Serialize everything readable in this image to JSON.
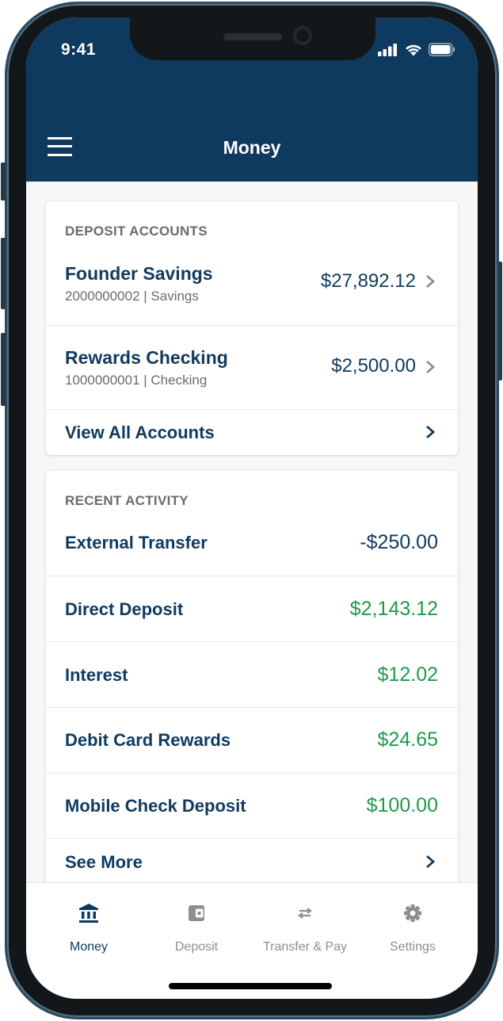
{
  "status_bar": {
    "time": "9:41"
  },
  "header": {
    "title": "Money",
    "menu_icon": "hamburger-menu-icon"
  },
  "deposit_accounts": {
    "label": "DEPOSIT ACCOUNTS",
    "accounts": [
      {
        "name": "Founder Savings",
        "number": "2000000002",
        "type": "Savings",
        "sub": "2000000002 | Savings",
        "balance": "$27,892.12"
      },
      {
        "name": "Rewards Checking",
        "number": "1000000001",
        "type": "Checking",
        "sub": "1000000001 | Checking",
        "balance": "$2,500.00"
      }
    ],
    "view_all_label": "View All Accounts"
  },
  "recent_activity": {
    "label": "RECENT ACTIVITY",
    "items": [
      {
        "name": "External Transfer",
        "amount": "-$250.00",
        "kind": "debit"
      },
      {
        "name": "Direct Deposit",
        "amount": "$2,143.12",
        "kind": "credit"
      },
      {
        "name": "Interest",
        "amount": "$12.02",
        "kind": "credit"
      },
      {
        "name": "Debit Card Rewards",
        "amount": "$24.65",
        "kind": "credit"
      },
      {
        "name": "Mobile Check Deposit",
        "amount": "$100.00",
        "kind": "credit"
      }
    ],
    "see_more_label": "See More"
  },
  "tab_bar": {
    "tabs": [
      {
        "label": "Money",
        "icon": "bank-icon",
        "active": true
      },
      {
        "label": "Deposit",
        "icon": "wallet-icon",
        "active": false
      },
      {
        "label": "Transfer & Pay",
        "icon": "transfer-arrows-icon",
        "active": false
      },
      {
        "label": "Settings",
        "icon": "gear-icon",
        "active": false
      }
    ]
  },
  "colors": {
    "brand_navy": "#0f3a5f",
    "credit_green": "#1f9a4a",
    "muted_gray": "#8e8e8e",
    "label_gray": "#6b6b6b"
  }
}
